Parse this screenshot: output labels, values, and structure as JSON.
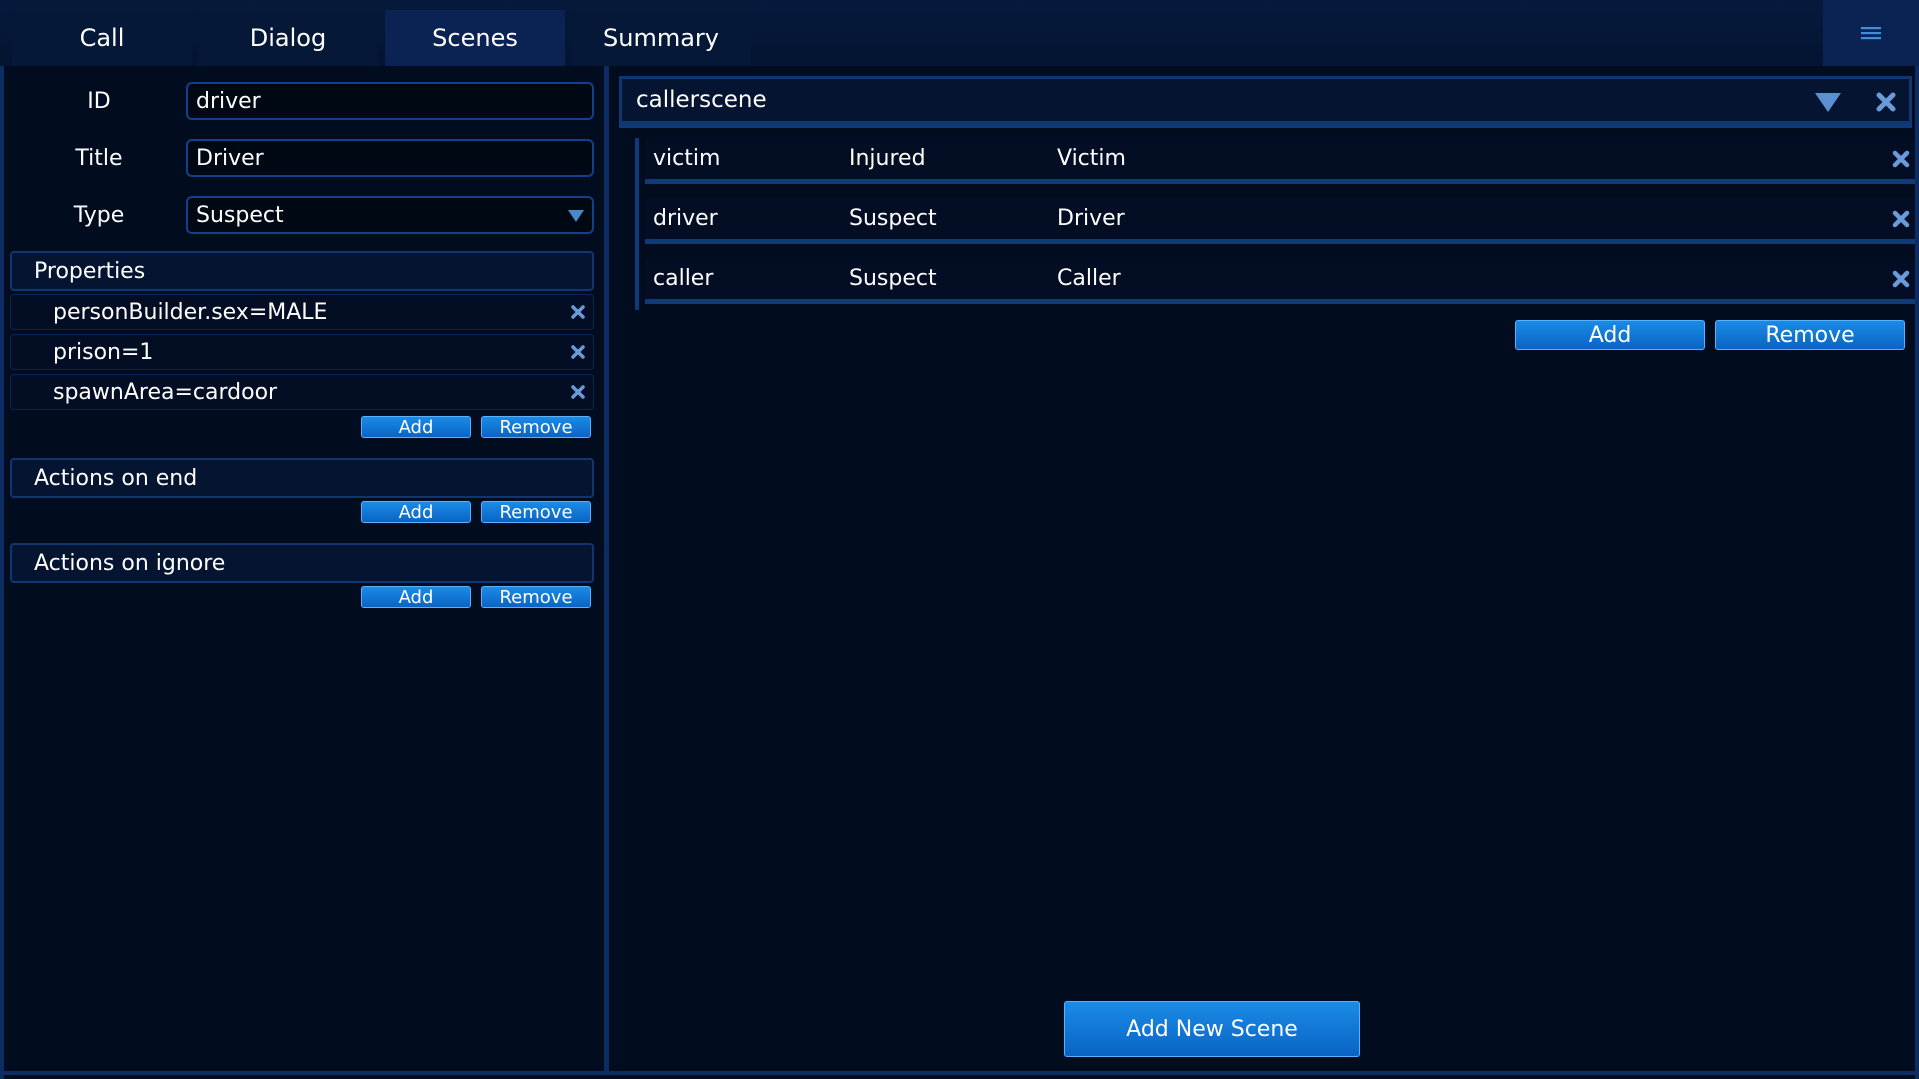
{
  "tabs": [
    {
      "label": "Call"
    },
    {
      "label": "Dialog"
    },
    {
      "label": "Scenes"
    },
    {
      "label": "Summary"
    }
  ],
  "active_tab": "Scenes",
  "menu_icon": "hamburger-menu-icon",
  "form": {
    "id_label": "ID",
    "id_value": "driver",
    "title_label": "Title",
    "title_value": "Driver",
    "type_label": "Type",
    "type_value": "Suspect"
  },
  "properties": {
    "header": "Properties",
    "items": [
      {
        "text": "personBuilder.sex=MALE"
      },
      {
        "text": "prison=1"
      },
      {
        "text": "spawnArea=cardoor"
      }
    ],
    "add_label": "Add",
    "remove_label": "Remove"
  },
  "actions_on_end": {
    "header": "Actions on end",
    "add_label": "Add",
    "remove_label": "Remove"
  },
  "actions_on_ignore": {
    "header": "Actions on ignore",
    "add_label": "Add",
    "remove_label": "Remove"
  },
  "scene": {
    "name": "callerscene",
    "roles": [
      {
        "id": "victim",
        "type": "Injured",
        "title": "Victim"
      },
      {
        "id": "driver",
        "type": "Suspect",
        "title": "Driver"
      },
      {
        "id": "caller",
        "type": "Suspect",
        "title": "Caller"
      }
    ],
    "add_label": "Add",
    "remove_label": "Remove"
  },
  "add_new_scene_label": "Add New Scene",
  "colors": {
    "background": "#020c1f",
    "accent": "#0a64c4",
    "border": "#0b2d63",
    "icon": "#5a8fd0"
  }
}
